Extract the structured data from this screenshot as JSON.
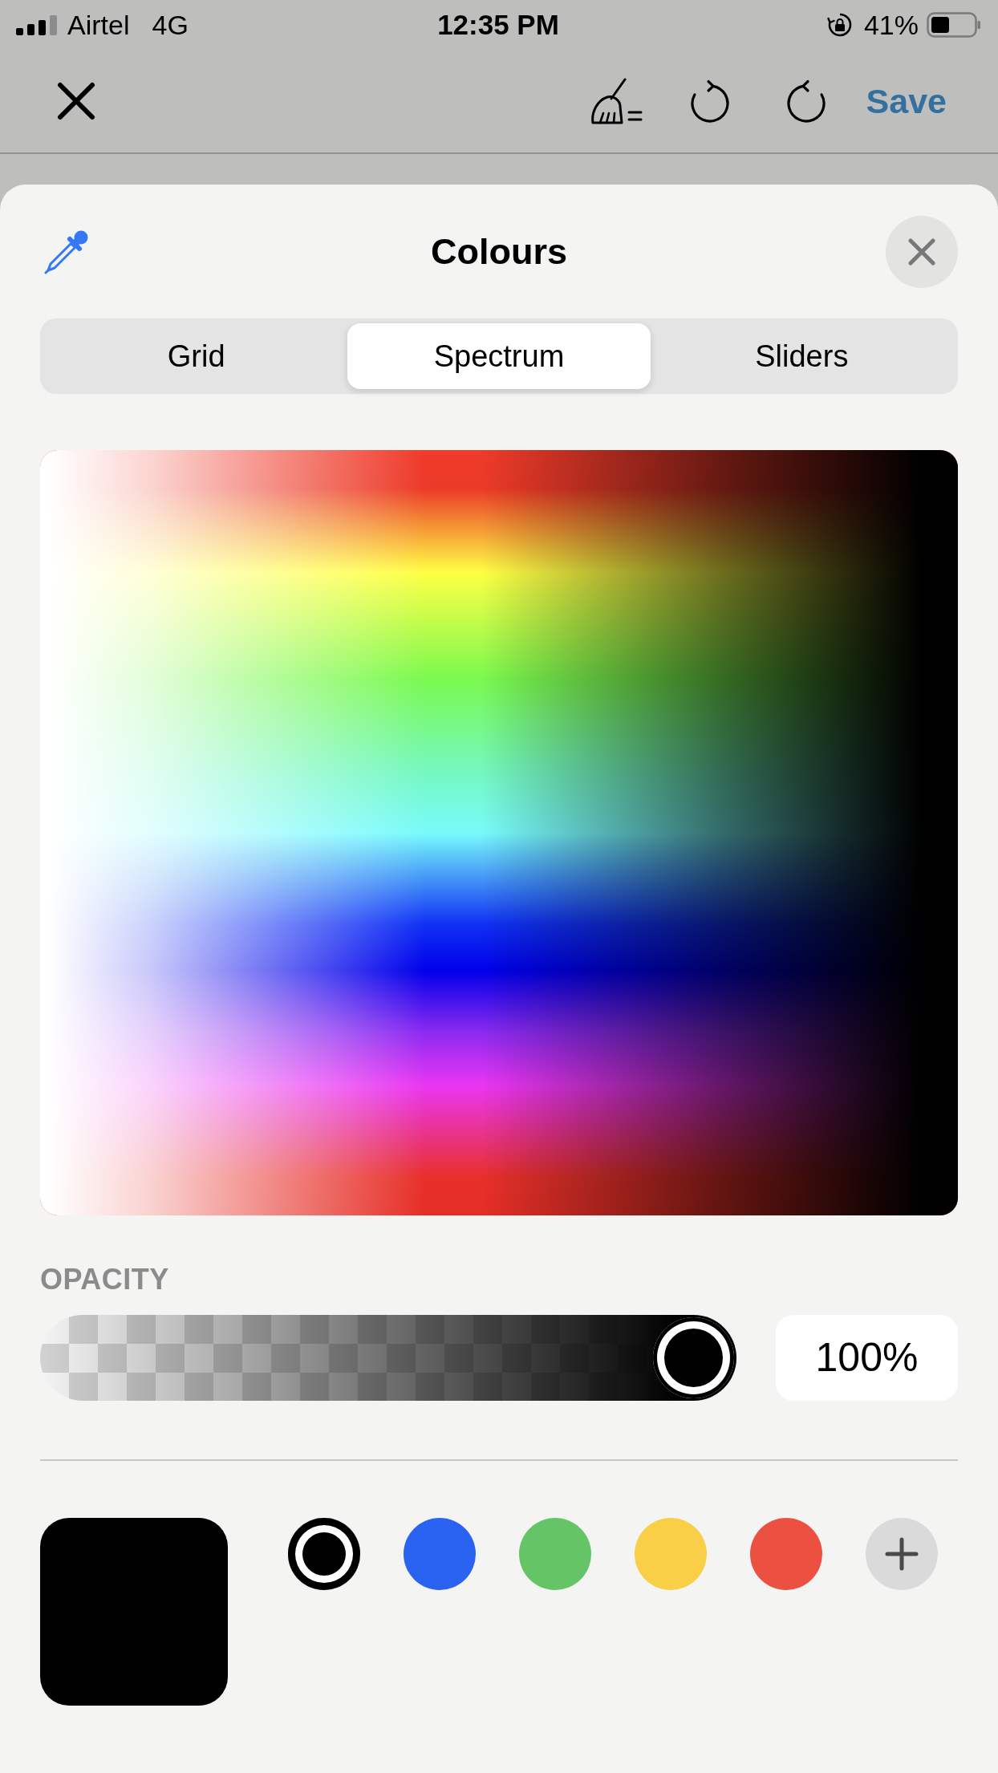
{
  "status_bar": {
    "carrier": "Airtel",
    "network": "4G",
    "time": "12:35 PM",
    "battery": "41%"
  },
  "toolbar": {
    "save": "Save"
  },
  "title": "Colours",
  "tabs": [
    {
      "label": "Grid",
      "selected": false
    },
    {
      "label": "Spectrum",
      "selected": true
    },
    {
      "label": "Sliders",
      "selected": false
    }
  ],
  "opacity": {
    "label": "OPACITY",
    "level": 1,
    "reading": "100%"
  },
  "swatches": [
    {
      "color": "#000000",
      "selected": true
    },
    {
      "color": "#2a63f2",
      "selected": false
    },
    {
      "color": "#65c466",
      "selected": false
    },
    {
      "color": "#f8cf46",
      "selected": false
    },
    {
      "color": "#eb5040",
      "selected": false
    }
  ]
}
